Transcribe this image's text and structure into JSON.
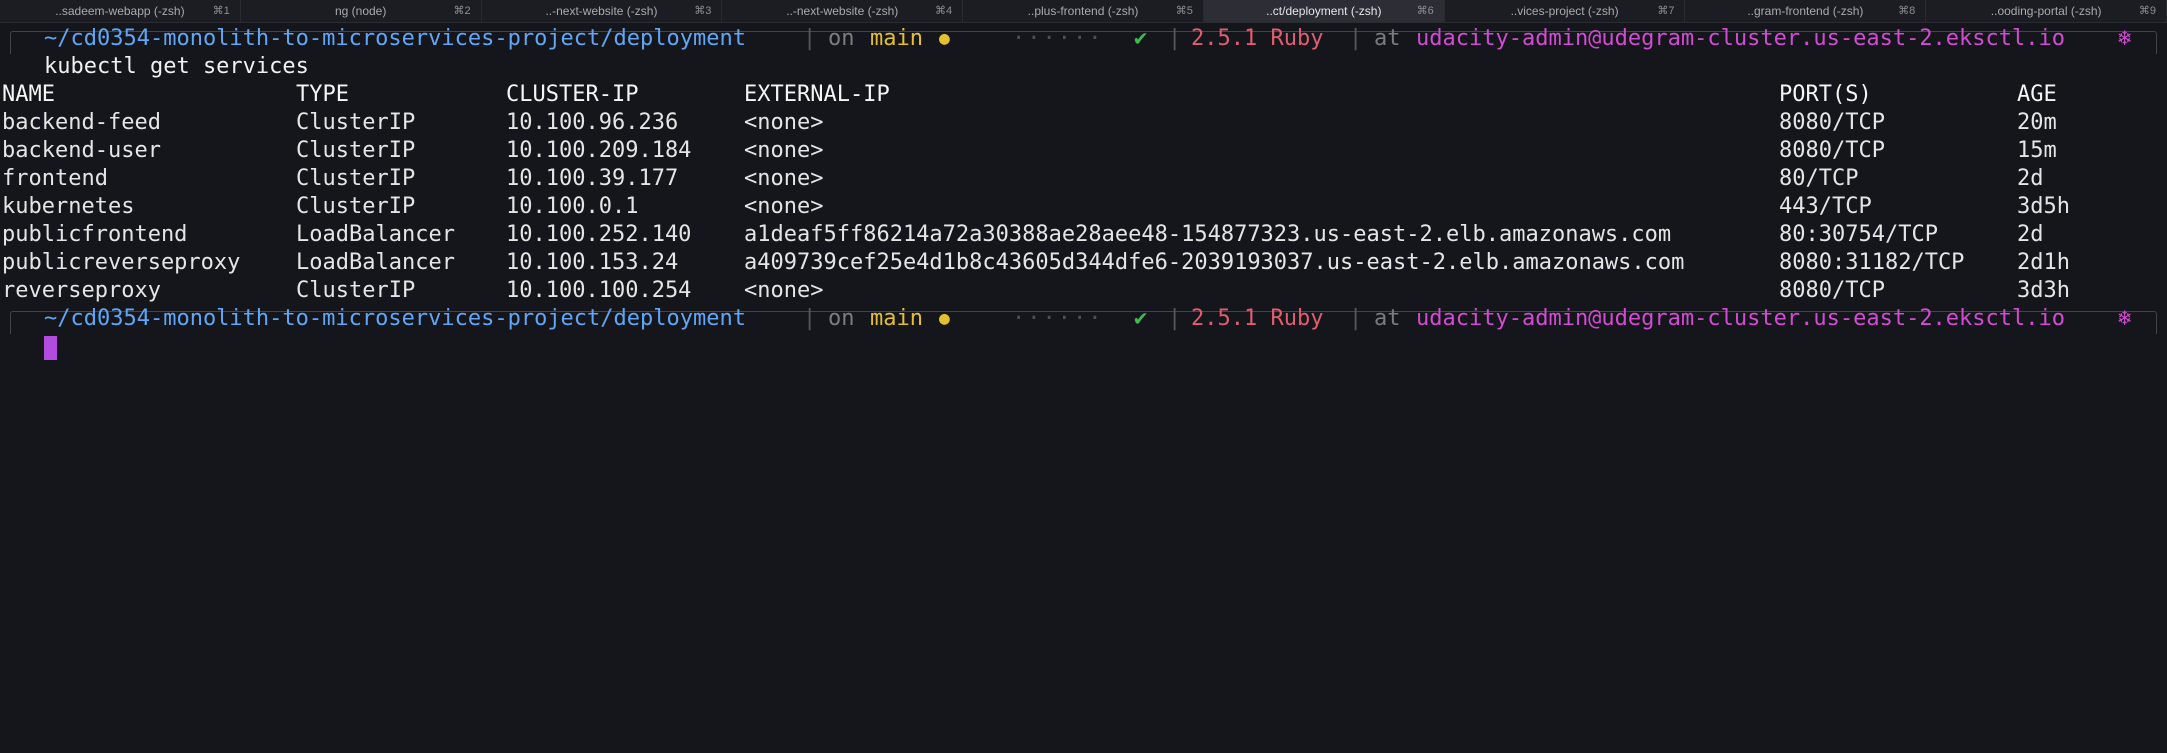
{
  "tabs": [
    {
      "title": "..sadeem-webapp (-zsh)",
      "shortcut": "⌘1",
      "active": false
    },
    {
      "title": "ng (node)",
      "shortcut": "⌘2",
      "active": false
    },
    {
      "title": "..-next-website (-zsh)",
      "shortcut": "⌘3",
      "active": false
    },
    {
      "title": "..-next-website (-zsh)",
      "shortcut": "⌘4",
      "active": false
    },
    {
      "title": "..plus-frontend (-zsh)",
      "shortcut": "⌘5",
      "active": false
    },
    {
      "title": "..ct/deployment (-zsh)",
      "shortcut": "⌘6",
      "active": true
    },
    {
      "title": "..vices-project (-zsh)",
      "shortcut": "⌘7",
      "active": false
    },
    {
      "title": "..gram-frontend (-zsh)",
      "shortcut": "⌘8",
      "active": false
    },
    {
      "title": "..ooding-portal (-zsh)",
      "shortcut": "⌘9",
      "active": false
    }
  ],
  "prompt": {
    "path": "~/cd0354-monolith-to-microservices-project/deployment",
    "sep": "|",
    "on": "on",
    "branch": "main",
    "dirty_dot": "●",
    "dots": "······",
    "check": "✔",
    "ruby_version": "2.5.1 Ruby",
    "at": "at",
    "context": "udacity-admin@udegram-cluster.us-east-2.eksctl.io",
    "k8s_symbol": "❄"
  },
  "command": "kubectl get services",
  "table": {
    "headers": [
      "NAME",
      "TYPE",
      "CLUSTER-IP",
      "EXTERNAL-IP",
      "PORT(S)",
      "AGE"
    ],
    "rows": [
      [
        "backend-feed",
        "ClusterIP",
        "10.100.96.236",
        "<none>",
        "8080/TCP",
        "20m"
      ],
      [
        "backend-user",
        "ClusterIP",
        "10.100.209.184",
        "<none>",
        "8080/TCP",
        "15m"
      ],
      [
        "frontend",
        "ClusterIP",
        "10.100.39.177",
        "<none>",
        "80/TCP",
        "2d"
      ],
      [
        "kubernetes",
        "ClusterIP",
        "10.100.0.1",
        "<none>",
        "443/TCP",
        "3d5h"
      ],
      [
        "publicfrontend",
        "LoadBalancer",
        "10.100.252.140",
        "a1deaf5ff86214a72a30388ae28aee48-154877323.us-east-2.elb.amazonaws.com",
        "80:30754/TCP",
        "2d"
      ],
      [
        "publicreverseproxy",
        "LoadBalancer",
        "10.100.153.24",
        "a409739cef25e4d1b8c43605d344dfe6-2039193037.us-east-2.elb.amazonaws.com",
        "8080:31182/TCP",
        "2d1h"
      ],
      [
        "reverseproxy",
        "ClusterIP",
        "10.100.100.254",
        "<none>",
        "8080/TCP",
        "3d3h"
      ]
    ]
  },
  "colors": {
    "background": "#15161b",
    "path": "#5fa7f6",
    "branch": "#e4c02f",
    "check": "#3fb950",
    "ruby": "#e05d6f",
    "context": "#d24bd3",
    "cursor": "#b24be0"
  }
}
